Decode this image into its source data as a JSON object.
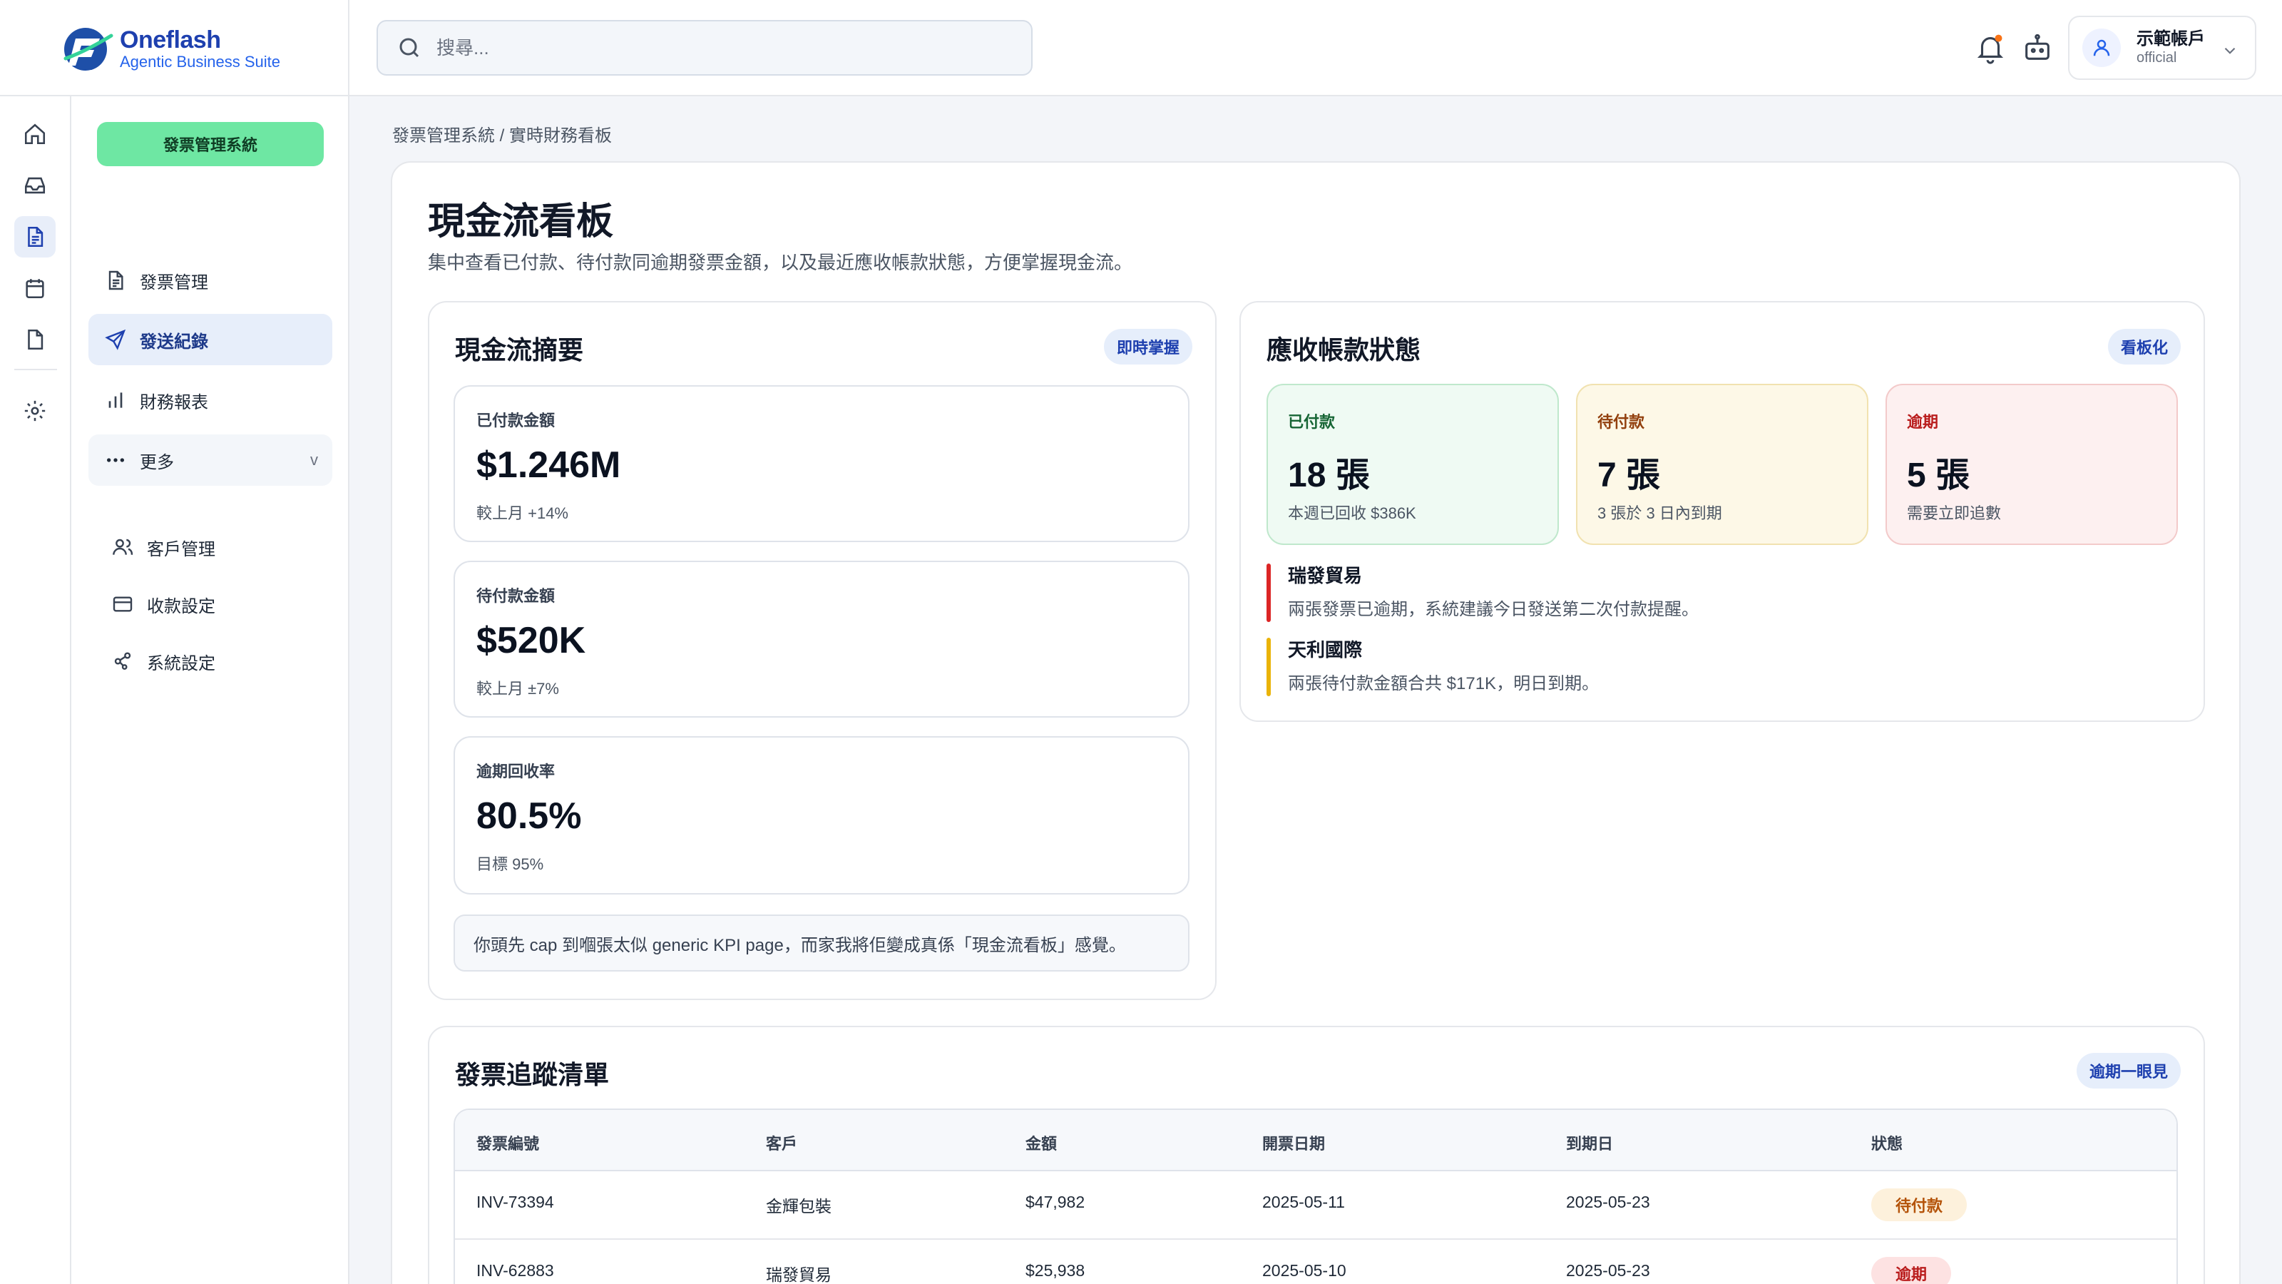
{
  "brand": {
    "name": "Oneflash",
    "tagline": "Agentic Business Suite"
  },
  "search": {
    "placeholder": "搜尋..."
  },
  "account": {
    "name": "示範帳戶",
    "role": "official"
  },
  "sidebar": {
    "system_button": "發票管理系統",
    "items": [
      {
        "label": "發票管理",
        "icon": "document-icon"
      },
      {
        "label": "發送紀錄",
        "icon": "send-icon"
      },
      {
        "label": "財務報表",
        "icon": "bar-chart-icon"
      },
      {
        "label": "更多",
        "icon": "more-icon"
      }
    ],
    "more_chevron": "v",
    "sub_items": [
      {
        "label": "客戶管理",
        "icon": "users-icon"
      },
      {
        "label": "收款設定",
        "icon": "card-icon"
      },
      {
        "label": "系統設定",
        "icon": "settings-share-icon"
      }
    ]
  },
  "breadcrumb": "發票管理系統 / 實時財務看板",
  "page": {
    "title": "現金流看板",
    "description": "集中查看已付款、待付款同逾期發票金額，以及最近應收帳款狀態，方便掌握現金流。"
  },
  "cashflow": {
    "title": "現金流摘要",
    "pill": "即時掌握",
    "kpis": [
      {
        "label": "已付款金額",
        "value": "$1.246M",
        "sub": "較上月 +14%"
      },
      {
        "label": "待付款金額",
        "value": "$520K",
        "sub": "較上月 ±7%"
      },
      {
        "label": "逾期回收率",
        "value": "80.5%",
        "sub": "目標 95%"
      }
    ],
    "note": "你頭先 cap 到嗰張太似 generic KPI page，而家我將佢變成真係「現金流看板」感覺。"
  },
  "receivables": {
    "title": "應收帳款狀態",
    "pill": "看板化",
    "stats": [
      {
        "label": "已付款",
        "value": "18 張",
        "sub": "本週已回收 $386K",
        "color": "#166534",
        "bg": "#effaf3",
        "border": "#bfe8cc"
      },
      {
        "label": "待付款",
        "value": "7 張",
        "sub": "3 張於 3 日內到期",
        "color": "#92400e",
        "bg": "#fdf8e7",
        "border": "#f1e2b0"
      },
      {
        "label": "逾期",
        "value": "5 張",
        "sub": "需要立即追數",
        "color": "#b91c1c",
        "bg": "#fdf0f0",
        "border": "#f3caca"
      }
    ],
    "alerts": [
      {
        "title": "瑞發貿易",
        "text": "兩張發票已逾期，系統建議今日發送第二次付款提醒。",
        "color": "#dc2626"
      },
      {
        "title": "天利國際",
        "text": "兩張待付款金額合共 $171K，明日到期。",
        "color": "#eab308"
      }
    ]
  },
  "invoices": {
    "title": "發票追蹤清單",
    "pill": "逾期一眼見",
    "columns": [
      "發票編號",
      "客戶",
      "金額",
      "開票日期",
      "到期日",
      "狀態"
    ],
    "rows": [
      {
        "id": "INV-73394",
        "client": "金輝包裝",
        "amount": "$47,982",
        "issued": "2025-05-11",
        "due": "2025-05-23",
        "status": "待付款"
      },
      {
        "id": "INV-62883",
        "client": "瑞發貿易",
        "amount": "$25,938",
        "issued": "2025-05-10",
        "due": "2025-05-23",
        "status": "逾期"
      }
    ],
    "status_colors": {
      "待付款": {
        "bg": "#fdf1dc",
        "fg": "#b45309"
      },
      "逾期": {
        "bg": "#fde2e2",
        "fg": "#b91c1c"
      }
    }
  }
}
